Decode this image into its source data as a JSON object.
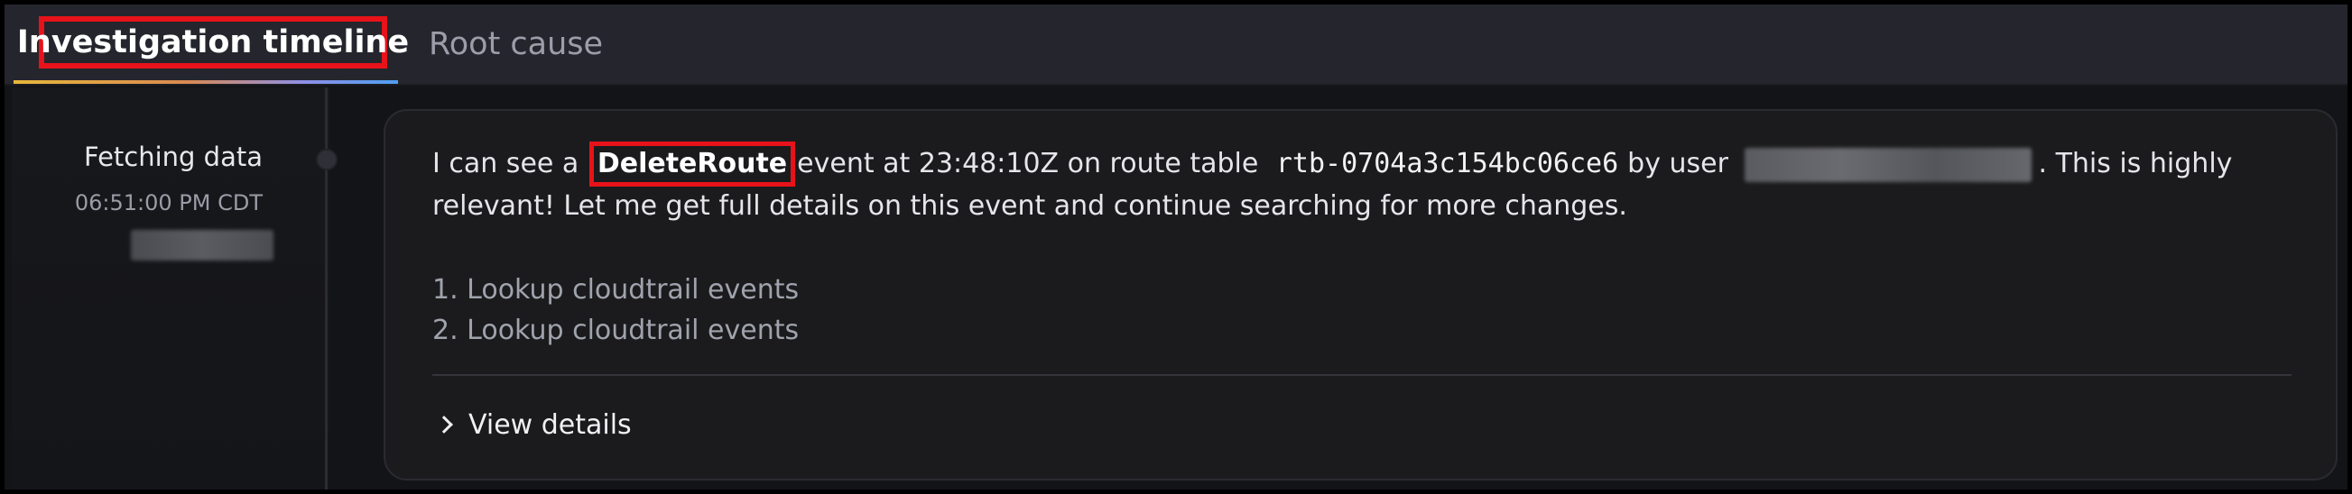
{
  "tabs": {
    "timeline_label": "Investigation timeline",
    "rootcause_label": "Root cause"
  },
  "timeline": {
    "step_title": "Fetching data",
    "step_time": "06:51:00 PM CDT"
  },
  "message": {
    "part1": "I can see a",
    "highlight": "DeleteRoute",
    "part2": "event at 23:48:10Z on route table",
    "route_table_id": "rtb-0704a3c154bc06ce6",
    "part3": "by user",
    "part4": ". This is highly relevant! Let me get full details on this event and continue searching for more changes."
  },
  "steps": [
    "1. Lookup cloudtrail events",
    "2. Lookup cloudtrail events"
  ],
  "details_label": "View details",
  "colors": {
    "highlight_border": "#e8121a",
    "background": "#131417",
    "card": "#1b1b1d"
  }
}
